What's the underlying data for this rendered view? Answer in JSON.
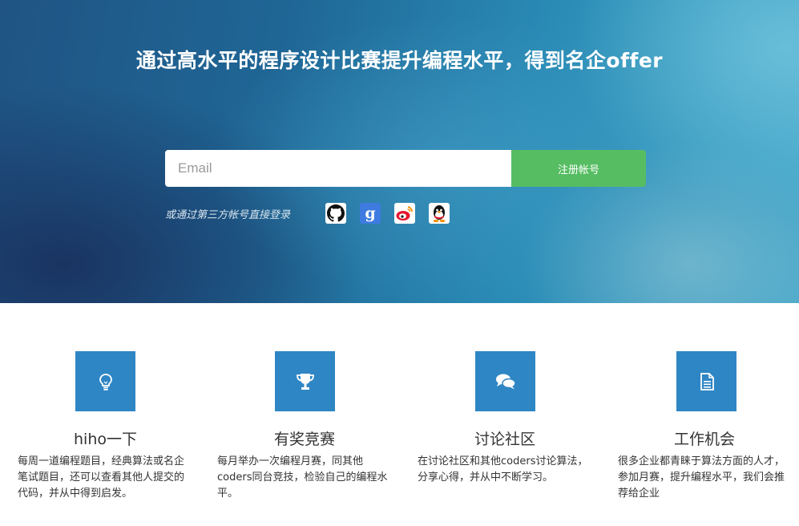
{
  "hero": {
    "headline": "通过高水平的程序设计比赛提升编程水平，得到名企offer",
    "email_placeholder": "Email",
    "signup_label": "注册帐号",
    "third_party_label": "或通过第三方帐号直接登录",
    "social_icons": [
      "github-icon",
      "google-icon",
      "weibo-icon",
      "qq-icon",
      "microsoft-icon"
    ]
  },
  "features": [
    {
      "icon": "lightbulb-icon",
      "title": "hiho一下",
      "desc": "每周一道编程题目，经典算法或名企笔试题目，还可以查看其他人提交的代码，并从中得到启发。"
    },
    {
      "icon": "trophy-icon",
      "title": "有奖竞赛",
      "desc": "每月举办一次编程月赛，同其他coders同台竞技，检验自己的编程水平。"
    },
    {
      "icon": "comments-icon",
      "title": "讨论社区",
      "desc": "在讨论社区和其他coders讨论算法，分享心得，并从中不断学习。"
    },
    {
      "icon": "document-icon",
      "title": "工作机会",
      "desc": "很多企业都青睐于算法方面的人才，参加月赛，提升编程水平，我们会推荐给企业"
    }
  ],
  "colors": {
    "accent_green": "#56bd62",
    "feature_blue": "#2f86c4"
  }
}
